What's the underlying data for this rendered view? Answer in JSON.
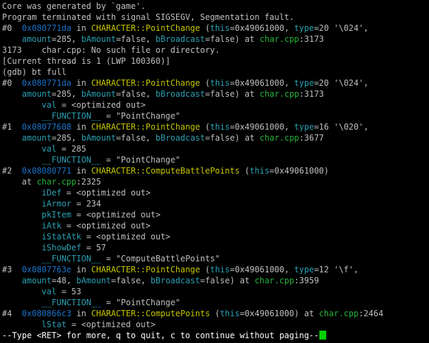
{
  "terminal": {
    "colors": {
      "background": "#000000",
      "text": "#c0c0c0",
      "address": "#1a73c8",
      "function": "#c8c800",
      "param": "#2aa1b3",
      "file": "#27b43a",
      "cursor": "#00d000"
    },
    "lines": [
      [
        {
          "t": "Core was generated by `game'.",
          "c": "plain"
        }
      ],
      [
        {
          "t": "Program terminated with signal SIGSEGV, Segmentation fault.",
          "c": "plain"
        }
      ],
      [
        {
          "t": "#0  ",
          "c": "plain"
        },
        {
          "t": "0x080771da",
          "c": "addr"
        },
        {
          "t": " in ",
          "c": "plain"
        },
        {
          "t": "CHARACTER::PointChange",
          "c": "func"
        },
        {
          "t": " (",
          "c": "plain"
        },
        {
          "t": "this",
          "c": "param"
        },
        {
          "t": "=0x49061000, ",
          "c": "plain"
        },
        {
          "t": "type",
          "c": "param"
        },
        {
          "t": "=20 '\\024',",
          "c": "plain"
        }
      ],
      [
        {
          "t": "    ",
          "c": "plain"
        },
        {
          "t": "amount",
          "c": "param"
        },
        {
          "t": "=285, ",
          "c": "plain"
        },
        {
          "t": "bAmount",
          "c": "param"
        },
        {
          "t": "=false, ",
          "c": "plain"
        },
        {
          "t": "bBroadcast",
          "c": "param"
        },
        {
          "t": "=false) at ",
          "c": "plain"
        },
        {
          "t": "char.cpp",
          "c": "file"
        },
        {
          "t": ":3173",
          "c": "plain"
        }
      ],
      [
        {
          "t": "3173    char.cpp: No such file or directory.",
          "c": "plain"
        }
      ],
      [
        {
          "t": "[Current thread is 1 (LWP 100360)]",
          "c": "plain"
        }
      ],
      [
        {
          "t": "(gdb) bt full",
          "c": "plain"
        }
      ],
      [
        {
          "t": "#0  ",
          "c": "plain"
        },
        {
          "t": "0x080771da",
          "c": "addr"
        },
        {
          "t": " in ",
          "c": "plain"
        },
        {
          "t": "CHARACTER::PointChange",
          "c": "func"
        },
        {
          "t": " (",
          "c": "plain"
        },
        {
          "t": "this",
          "c": "param"
        },
        {
          "t": "=0x49061000, ",
          "c": "plain"
        },
        {
          "t": "type",
          "c": "param"
        },
        {
          "t": "=20 '\\024',",
          "c": "plain"
        }
      ],
      [
        {
          "t": "    ",
          "c": "plain"
        },
        {
          "t": "amount",
          "c": "param"
        },
        {
          "t": "=285, ",
          "c": "plain"
        },
        {
          "t": "bAmount",
          "c": "param"
        },
        {
          "t": "=false, ",
          "c": "plain"
        },
        {
          "t": "bBroadcast",
          "c": "param"
        },
        {
          "t": "=false) at ",
          "c": "plain"
        },
        {
          "t": "char.cpp",
          "c": "file"
        },
        {
          "t": ":3173",
          "c": "plain"
        }
      ],
      [
        {
          "t": "        ",
          "c": "plain"
        },
        {
          "t": "val",
          "c": "param"
        },
        {
          "t": " = <optimized out>",
          "c": "plain"
        }
      ],
      [
        {
          "t": "        ",
          "c": "plain"
        },
        {
          "t": "__FUNCTION__",
          "c": "param"
        },
        {
          "t": " = \"PointChange\"",
          "c": "plain"
        }
      ],
      [
        {
          "t": "#1  ",
          "c": "plain"
        },
        {
          "t": "0x08077608",
          "c": "addr"
        },
        {
          "t": " in ",
          "c": "plain"
        },
        {
          "t": "CHARACTER::PointChange",
          "c": "func"
        },
        {
          "t": " (",
          "c": "plain"
        },
        {
          "t": "this",
          "c": "param"
        },
        {
          "t": "=0x49061000, ",
          "c": "plain"
        },
        {
          "t": "type",
          "c": "param"
        },
        {
          "t": "=16 '\\020',",
          "c": "plain"
        }
      ],
      [
        {
          "t": "    ",
          "c": "plain"
        },
        {
          "t": "amount",
          "c": "param"
        },
        {
          "t": "=285, ",
          "c": "plain"
        },
        {
          "t": "bAmount",
          "c": "param"
        },
        {
          "t": "=false, ",
          "c": "plain"
        },
        {
          "t": "bBroadcast",
          "c": "param"
        },
        {
          "t": "=false) at ",
          "c": "plain"
        },
        {
          "t": "char.cpp",
          "c": "file"
        },
        {
          "t": ":3677",
          "c": "plain"
        }
      ],
      [
        {
          "t": "        ",
          "c": "plain"
        },
        {
          "t": "val",
          "c": "param"
        },
        {
          "t": " = 285",
          "c": "plain"
        }
      ],
      [
        {
          "t": "        ",
          "c": "plain"
        },
        {
          "t": "__FUNCTION__",
          "c": "param"
        },
        {
          "t": " = \"PointChange\"",
          "c": "plain"
        }
      ],
      [
        {
          "t": "#2  ",
          "c": "plain"
        },
        {
          "t": "0x08080771",
          "c": "addr"
        },
        {
          "t": " in ",
          "c": "plain"
        },
        {
          "t": "CHARACTER::ComputeBattlePoints",
          "c": "func"
        },
        {
          "t": " (",
          "c": "plain"
        },
        {
          "t": "this",
          "c": "param"
        },
        {
          "t": "=0x49061000)",
          "c": "plain"
        }
      ],
      [
        {
          "t": "    at ",
          "c": "plain"
        },
        {
          "t": "char.cpp",
          "c": "file"
        },
        {
          "t": ":2325",
          "c": "plain"
        }
      ],
      [
        {
          "t": "        ",
          "c": "plain"
        },
        {
          "t": "iDef",
          "c": "param"
        },
        {
          "t": " = <optimized out>",
          "c": "plain"
        }
      ],
      [
        {
          "t": "        ",
          "c": "plain"
        },
        {
          "t": "iArmor",
          "c": "param"
        },
        {
          "t": " = 234",
          "c": "plain"
        }
      ],
      [
        {
          "t": "        ",
          "c": "plain"
        },
        {
          "t": "pkItem",
          "c": "param"
        },
        {
          "t": " = <optimized out>",
          "c": "plain"
        }
      ],
      [
        {
          "t": "        ",
          "c": "plain"
        },
        {
          "t": "iAtk",
          "c": "param"
        },
        {
          "t": " = <optimized out>",
          "c": "plain"
        }
      ],
      [
        {
          "t": "        ",
          "c": "plain"
        },
        {
          "t": "iStatAtk",
          "c": "param"
        },
        {
          "t": " = <optimized out>",
          "c": "plain"
        }
      ],
      [
        {
          "t": "        ",
          "c": "plain"
        },
        {
          "t": "iShowDef",
          "c": "param"
        },
        {
          "t": " = 57",
          "c": "plain"
        }
      ],
      [
        {
          "t": "        ",
          "c": "plain"
        },
        {
          "t": "__FUNCTION__",
          "c": "param"
        },
        {
          "t": " = \"ComputeBattlePoints\"",
          "c": "plain"
        }
      ],
      [
        {
          "t": "#3  ",
          "c": "plain"
        },
        {
          "t": "0x0807763e",
          "c": "addr"
        },
        {
          "t": " in ",
          "c": "plain"
        },
        {
          "t": "CHARACTER::PointChange",
          "c": "func"
        },
        {
          "t": " (",
          "c": "plain"
        },
        {
          "t": "this",
          "c": "param"
        },
        {
          "t": "=0x49061000, ",
          "c": "plain"
        },
        {
          "t": "type",
          "c": "param"
        },
        {
          "t": "=12 '\\f',",
          "c": "plain"
        }
      ],
      [
        {
          "t": "    ",
          "c": "plain"
        },
        {
          "t": "amount",
          "c": "param"
        },
        {
          "t": "=48, ",
          "c": "plain"
        },
        {
          "t": "bAmount",
          "c": "param"
        },
        {
          "t": "=false, ",
          "c": "plain"
        },
        {
          "t": "bBroadcast",
          "c": "param"
        },
        {
          "t": "=false) at ",
          "c": "plain"
        },
        {
          "t": "char.cpp",
          "c": "file"
        },
        {
          "t": ":3959",
          "c": "plain"
        }
      ],
      [
        {
          "t": "        ",
          "c": "plain"
        },
        {
          "t": "val",
          "c": "param"
        },
        {
          "t": " = 53",
          "c": "plain"
        }
      ],
      [
        {
          "t": "        ",
          "c": "plain"
        },
        {
          "t": "__FUNCTION__",
          "c": "param"
        },
        {
          "t": " = \"PointChange\"",
          "c": "plain"
        }
      ],
      [
        {
          "t": "#4  ",
          "c": "plain"
        },
        {
          "t": "0x080866c3",
          "c": "addr"
        },
        {
          "t": " in ",
          "c": "plain"
        },
        {
          "t": "CHARACTER::ComputePoints",
          "c": "func"
        },
        {
          "t": " (",
          "c": "plain"
        },
        {
          "t": "this",
          "c": "param"
        },
        {
          "t": "=0x49061000) at ",
          "c": "plain"
        },
        {
          "t": "char.cpp",
          "c": "file"
        },
        {
          "t": ":2464",
          "c": "plain"
        }
      ],
      [
        {
          "t": "        ",
          "c": "plain"
        },
        {
          "t": "lStat",
          "c": "param"
        },
        {
          "t": " = <optimized out>",
          "c": "plain"
        }
      ]
    ],
    "pager_prompt": "--Type <RET> for more, q to quit, c to continue without paging--",
    "cursor_icon": "block-cursor-icon"
  }
}
